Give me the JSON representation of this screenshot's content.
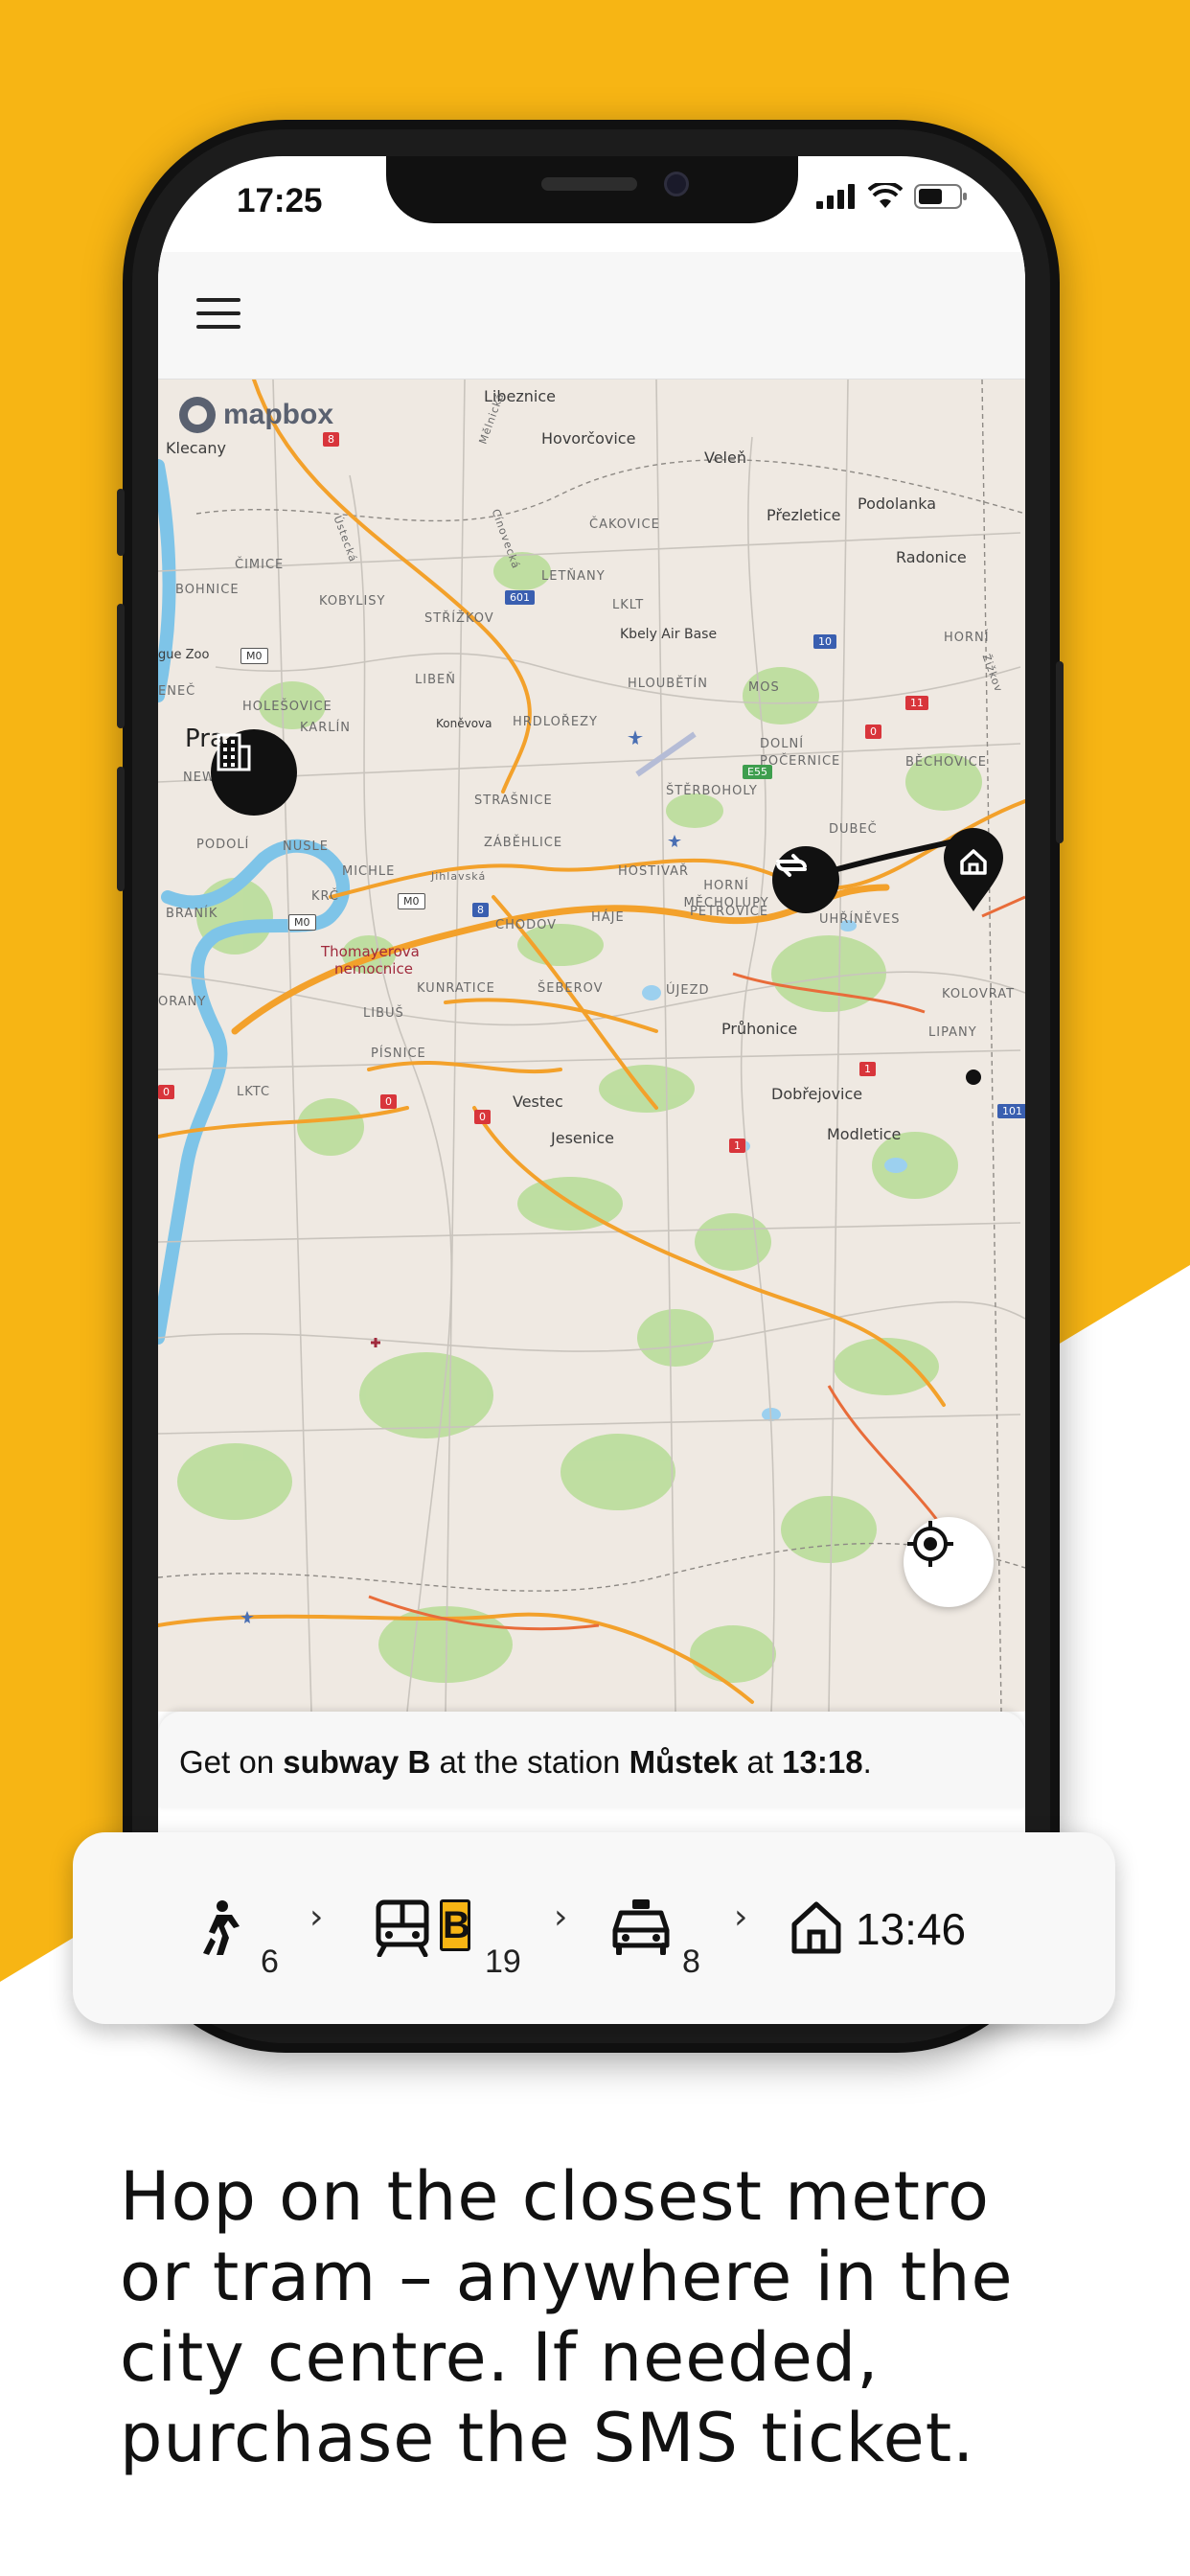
{
  "colors": {
    "brand_yellow": "#f7b514",
    "marker_black": "#111111",
    "route_orange": "#f3a12b",
    "river_blue": "#7ec4e8",
    "green_areas": "#a8d88a"
  },
  "status_bar": {
    "time": "17:25",
    "icons": [
      "signal-icon",
      "wifi-icon",
      "battery-icon"
    ]
  },
  "header": {
    "menu_icon": "hamburger-menu-icon"
  },
  "map": {
    "provider": "mapbox",
    "places": {
      "libeznice": "Libeznice",
      "melnicka": "Mělnická",
      "klecany": "Klecany",
      "hovorcovice": "Hovorčovice",
      "velen": "Veleň",
      "podolanka": "Podolanka",
      "prezletice": "Přezletice",
      "cakovice": "ČAKOVICE",
      "radonice": "Radonice",
      "usticka": "Ústecká",
      "cimice": "ČIMICE",
      "cihelna": "Cínovecká",
      "letnany": "LETŇANY",
      "bohnice": "BOHNICE",
      "kobylisy": "KOBYLISY",
      "strizkov": "STŘÍŽKOV",
      "lklt": "LKLT",
      "kbely": "Kbely Air Base",
      "horni": "HORNÍ",
      "zoo": "gue Zoo",
      "libec": "LIBEŇ",
      "hloubetin": "HLOUBĚTÍN",
      "mos": "MOS",
      "zizkov": "Žižkov",
      "nenec": "ENEČ",
      "holesovice": "HOLEŠOVICE",
      "karlin": "KARLÍN",
      "konevova": "Koněvova",
      "hrdlorezy": "HRDLOŘEZY",
      "praha": "Pra",
      "dolni_pocernice": "DOLNÍ POČERNICE",
      "bechovice": "BĚCHOVICE",
      "new": "NEW",
      "strasnice": "STRAŠNICE",
      "sterboholy": "ŠTĚRBOHOLY",
      "dubec": "DUBEČ",
      "podoli": "PODOLÍ",
      "nusle": "NUSLE",
      "zabehlice": "ZÁBĚHLICE",
      "hostivar": "HOSTIVAŘ",
      "michle": "MICHLE",
      "jihlavska": "Jihlavská",
      "horni_mecholupy": "HORNÍ MĚCHOLUPY",
      "krc": "KRČ",
      "branik": "BRANÍK",
      "chodov": "CHODOV",
      "haje": "HÁJE",
      "petrovice": "PETROVICE",
      "uhrineves": "UHŘÍNĚVES",
      "thomayerova": "Thomayerova",
      "nemocnice": "nemocnice",
      "kunratice": "KUNRATICE",
      "seberov": "ŠEBEROV",
      "ujezd": "ÚJEZD",
      "kolovrat": "KOLOVRAT",
      "orany": "ORANY",
      "libus": "LIBUŠ",
      "pruhonice": "Průhonice",
      "lipany": "LIPANY",
      "pisnice": "PÍSNICE",
      "lktc": "LKTC",
      "vestec": "Vestec",
      "dobrejovice": "Dobřejovice",
      "jesenice": "Jesenice",
      "modletice": "Modletice"
    },
    "road_badges": {
      "r8a": "8",
      "r601": "601",
      "m0a": "M0",
      "r10": "10",
      "r11": "11",
      "r0a": "0",
      "e55": "E55",
      "m0b": "M0",
      "r8b": "8",
      "m0c": "M0",
      "r1a": "1",
      "r0b": "0",
      "r0c": "0",
      "r0d": "0",
      "r1b": "1",
      "r101": "101"
    }
  },
  "instruction": {
    "prefix": "Get on ",
    "line": "subway B",
    "middle": " at the station ",
    "station": "Můstek",
    "at": " at ",
    "time": "13:18",
    "suffix": "."
  },
  "route_summary": {
    "walk_minutes": "6",
    "subway_line": "B",
    "subway_minutes": "19",
    "taxi_minutes": "8",
    "arrival_time": "13:46",
    "chevron": "›"
  },
  "caption": {
    "line1": "Hop on the closest metro",
    "line2": "or tram – anywhere in the",
    "line3": "city centre. If needed,",
    "line4": "purchase the SMS ticket."
  }
}
